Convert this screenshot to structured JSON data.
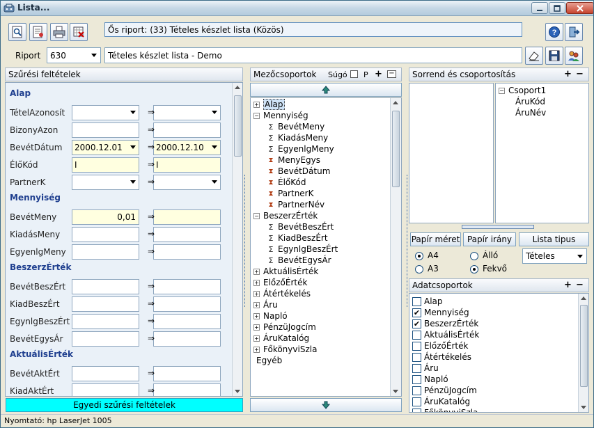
{
  "window": {
    "title": "Lista..."
  },
  "toolbar": {
    "report_origin": "Ős riport: (33)  Tételes készlet lista (Közös)",
    "riport_label": "Riport",
    "riport_value": "630",
    "riport_name": "Tételes készlet lista - Demo"
  },
  "filters": {
    "header": "Szűrési feltételek",
    "sections": [
      {
        "title": "Alap",
        "rows": [
          {
            "name": "TételAzonosít",
            "from": "",
            "to": "",
            "dropdown": true
          },
          {
            "name": "BizonyAzon",
            "from": "",
            "to": ""
          },
          {
            "name": "BevétDátum",
            "from": "2000.12.01",
            "to": "2000.12.10",
            "dropdown": true,
            "highlight": true
          },
          {
            "name": "ÉlőKód",
            "from": "I",
            "to": "I",
            "highlight": true
          },
          {
            "name": "PartnerK",
            "from": "",
            "to": "",
            "dropdown": true
          }
        ]
      },
      {
        "title": "Mennyiség",
        "rows": [
          {
            "name": "BevétMeny",
            "from": "0,01",
            "to": "",
            "highlight": true,
            "align_right": true
          },
          {
            "name": "KiadásMeny",
            "from": "",
            "to": ""
          },
          {
            "name": "EgyenlgMeny",
            "from": "",
            "to": ""
          }
        ]
      },
      {
        "title": "BeszerzÉrték",
        "rows": [
          {
            "name": "BevétBeszÉrt",
            "from": "",
            "to": ""
          },
          {
            "name": "KiadBeszÉrt",
            "from": "",
            "to": ""
          },
          {
            "name": "EgynlgBeszÉrt",
            "from": "",
            "to": ""
          },
          {
            "name": "BevétEgysÁr",
            "from": "",
            "to": ""
          }
        ]
      },
      {
        "title": "AktuálisÉrték",
        "rows": [
          {
            "name": "BevétAktÉrt",
            "from": "",
            "to": ""
          },
          {
            "name": "KiadAktÉrt",
            "from": "",
            "to": ""
          }
        ]
      }
    ],
    "arrow_glyph": "⇒",
    "custom_button": "Egyedi szűrési feltételek"
  },
  "fieldgroups": {
    "header": "Mezőcsoportok",
    "help": "Súgó",
    "p_label": "P",
    "tree": [
      {
        "label": "Alap",
        "type": "plus",
        "level": 0,
        "selected": true
      },
      {
        "label": "Mennyiség",
        "type": "minus",
        "level": 0
      },
      {
        "label": "BevétMeny",
        "type": "sigma",
        "level": 1
      },
      {
        "label": "KiadásMeny",
        "type": "sigma",
        "level": 1
      },
      {
        "label": "EgyenlgMeny",
        "type": "sigma",
        "level": 1
      },
      {
        "label": "MenyEgys",
        "type": "hourglass",
        "level": 1
      },
      {
        "label": "BevétDátum",
        "type": "hourglass",
        "level": 1
      },
      {
        "label": "ÉlőKód",
        "type": "hourglass",
        "level": 1
      },
      {
        "label": "PartnerK",
        "type": "hourglass",
        "level": 1
      },
      {
        "label": "PartnerNév",
        "type": "hourglass",
        "level": 1
      },
      {
        "label": "BeszerzÉrték",
        "type": "minus",
        "level": 0
      },
      {
        "label": "BevétBeszÉrt",
        "type": "sigma",
        "level": 1
      },
      {
        "label": "KiadBeszÉrt",
        "type": "sigma",
        "level": 1
      },
      {
        "label": "EgynlgBeszÉrt",
        "type": "sigma",
        "level": 1
      },
      {
        "label": "BevétEgysÁr",
        "type": "sigma",
        "level": 1
      },
      {
        "label": "AktuálisÉrték",
        "type": "plus",
        "level": 0
      },
      {
        "label": "ElőzőÉrték",
        "type": "plus",
        "level": 0
      },
      {
        "label": "Átértékelés",
        "type": "plus",
        "level": 0
      },
      {
        "label": "Áru",
        "type": "plus",
        "level": 0
      },
      {
        "label": "Napló",
        "type": "plus",
        "level": 0
      },
      {
        "label": "PénzüJogcím",
        "type": "plus",
        "level": 0
      },
      {
        "label": "ÁruKatalóg",
        "type": "plus",
        "level": 0
      },
      {
        "label": "FőkönyviSzla",
        "type": "plus",
        "level": 0
      },
      {
        "label": "Egyéb",
        "type": "none",
        "level": 0
      }
    ]
  },
  "order": {
    "header": "Sorrend és csoportosítás",
    "groups": [
      {
        "label": "Csoport1",
        "type": "minus",
        "level": 0
      },
      {
        "label": "ÁruKód",
        "type": "none",
        "level": 1
      },
      {
        "label": "ÁruNév",
        "type": "none",
        "level": 1
      }
    ]
  },
  "paper": {
    "size_label": "Papír méret",
    "orient_label": "Papír irány",
    "list_type_label": "Lista tipus",
    "size_options": [
      "A4",
      "A3"
    ],
    "size_selected": "A4",
    "orient_options": [
      "Álló",
      "Fekvő"
    ],
    "orient_selected": "Fekvő",
    "list_type_value": "Tételes"
  },
  "datagroups": {
    "header": "Adatcsoportok",
    "items": [
      {
        "label": "Alap",
        "checked": false
      },
      {
        "label": "Mennyiség",
        "checked": true
      },
      {
        "label": "BeszerzÉrték",
        "checked": true
      },
      {
        "label": "AktuálisÉrték",
        "checked": false
      },
      {
        "label": "ElőzőÉrték",
        "checked": false
      },
      {
        "label": "Átértékelés",
        "checked": false
      },
      {
        "label": "Áru",
        "checked": false
      },
      {
        "label": "Napló",
        "checked": false
      },
      {
        "label": "PénzüJogcím",
        "checked": false
      },
      {
        "label": "ÁruKatalóg",
        "checked": false
      },
      {
        "label": "FőkönyviSzla",
        "checked": false
      }
    ]
  },
  "status": {
    "printer": "Nyomtató: hp LaserJet 1005"
  },
  "colors": {
    "section_title": "#1f3f8f",
    "highlight_field": "#ffffe0",
    "custom_button_bg": "#00ffff",
    "accent_border": "#7fa2bf"
  }
}
